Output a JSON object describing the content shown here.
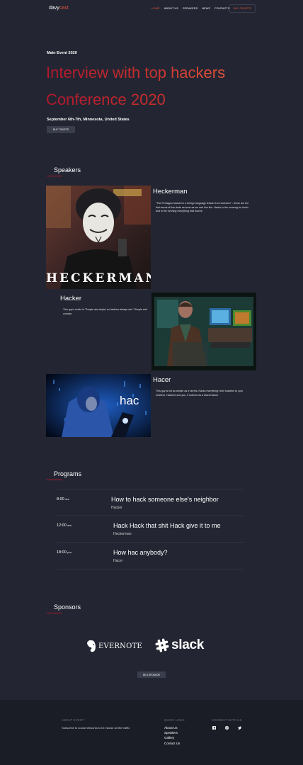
{
  "nav": {
    "logo_part1": "davy",
    "logo_part2": "cast",
    "links": [
      "HOME",
      "ABOUT US",
      "SPEAKERS",
      "NEWS",
      "CONTACTS"
    ],
    "cta": "BUY TICKETS"
  },
  "hero": {
    "kicker": "Main Event 2020",
    "title_line1": "Interview with top hackers",
    "title_line2": "Conference 2020",
    "date": "September 6th-7th, Minnesota, United States",
    "button": "BUY TICKETS"
  },
  "speakers": {
    "title": "Speakers",
    "items": [
      {
        "name": "Heckerman",
        "image_caption": "HECKERMAN",
        "description": "\"The Pentagon hacked in a foreign language lesson from boredom\" - these are the first words of this dude as soon as we met him live. Hacks in the morning for lunch and in the evening everything that moves."
      },
      {
        "name": "Hacker",
        "description": "This guy's motto is \"People are stupid, so hackers always win.\" Simple and concise."
      },
      {
        "name": "Hacer",
        "image_caption": "hac",
        "description": "This guy is not as simple as it seems. Hacks everything: from toasters to your mothers. Hackrrel and you, if ordered as a black hacker"
      }
    ]
  },
  "programs": {
    "title": "Programs",
    "items": [
      {
        "time": "8:00",
        "ampm": "am",
        "title": "How to hack someone else's neighbor",
        "speaker": "Hacker"
      },
      {
        "time": "12:00",
        "ampm": "am",
        "title": "Hack Hack that shit Hack give it to me",
        "speaker": "Heckerman"
      },
      {
        "time": "18:00",
        "ampm": "pm",
        "title": "How hac anybody?",
        "speaker": "Hacer"
      }
    ]
  },
  "sponsors": {
    "title": "Sponsors",
    "logos": [
      "EVERNOTE",
      "slack"
    ],
    "button": "BE A SPONSOR"
  },
  "footer": {
    "about_heading": "ABOUT EVENT",
    "about_text": "Subscribe to social networks to be vkurse all the traffic",
    "links_heading": "QUICK LINKS",
    "links": [
      "About Us",
      "Speakers",
      "Gallery",
      "Contact Us"
    ],
    "social_heading": "CONNECT WITH US",
    "social_icons": [
      "facebook-icon",
      "instagram-icon",
      "twitter-icon"
    ]
  },
  "colors": {
    "background": "#232632",
    "accent": "#e5533c",
    "accent_dark": "#b2172e",
    "footer_bg": "#1b1d26",
    "button_bg": "#3a3e4c"
  }
}
